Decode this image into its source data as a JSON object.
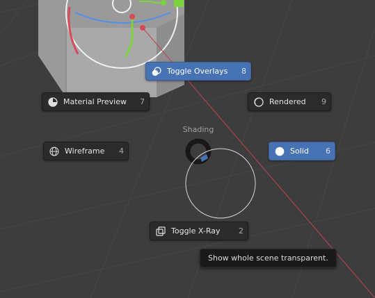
{
  "pie_menu": {
    "title": "Shading",
    "items": {
      "toggle_overlays": {
        "label": "Toggle Overlays",
        "key": "8",
        "icon": "overlay-icon"
      },
      "material_preview": {
        "label": "Material Preview",
        "key": "7",
        "icon": "material-sphere-icon"
      },
      "rendered": {
        "label": "Rendered",
        "key": "9",
        "icon": "rendered-sphere-icon"
      },
      "wireframe": {
        "label": "Wireframe",
        "key": "4",
        "icon": "wireframe-sphere-icon"
      },
      "solid": {
        "label": "Solid",
        "key": "6",
        "icon": "solid-sphere-icon"
      },
      "toggle_xray": {
        "label": "Toggle X-Ray",
        "key": "2",
        "icon": "xray-icon"
      }
    },
    "active_item": "solid"
  },
  "tooltip": {
    "text": "Show whole scene transparent."
  },
  "colors": {
    "viewport_background": "#3d3d3d",
    "active_item": "#4772b3",
    "item_background": "#2b2b2b",
    "x_axis": "#c4424f",
    "gizmo_blue": "#4f8ff0",
    "gizmo_green": "#7bd33d"
  }
}
